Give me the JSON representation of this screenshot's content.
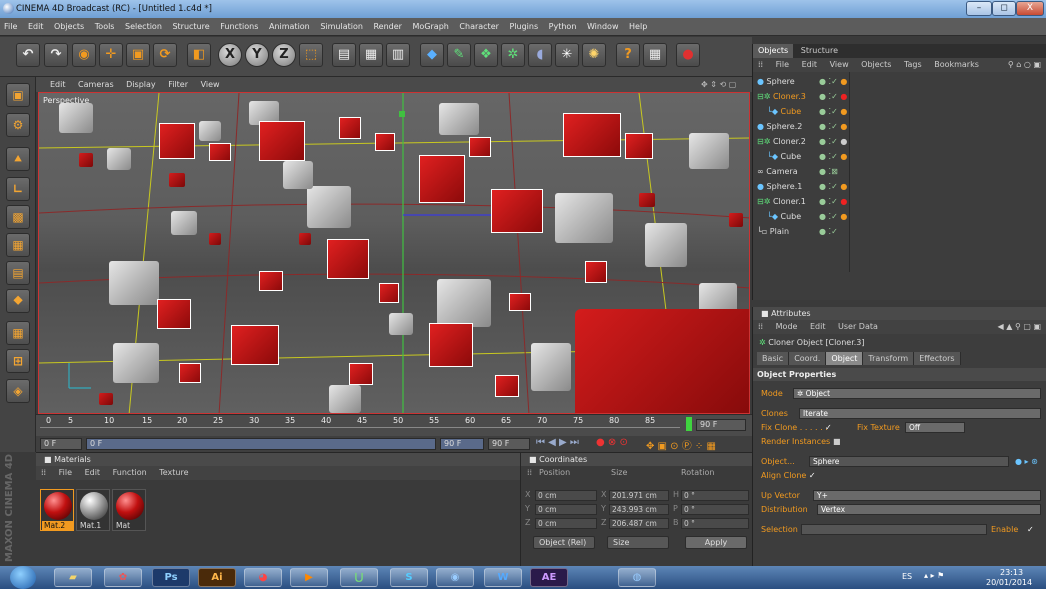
{
  "window": {
    "title": "CINEMA 4D Broadcast (RC) - [Untitled 1.c4d *]",
    "minimize": "–",
    "maximize": "◻",
    "close": "X"
  },
  "menubar": [
    "File",
    "Edit",
    "Objects",
    "Tools",
    "Selection",
    "Structure",
    "Functions",
    "Animation",
    "Simulation",
    "Render",
    "MoGraph",
    "Character",
    "Plugins",
    "Python",
    "Window",
    "Help"
  ],
  "viewport": {
    "menu": [
      "Edit",
      "Cameras",
      "Display",
      "Filter",
      "View"
    ],
    "label": "Perspective"
  },
  "timeline": {
    "ticks": [
      "0",
      "5",
      "10",
      "15",
      "20",
      "25",
      "30",
      "35",
      "40",
      "45",
      "50",
      "55",
      "60",
      "65",
      "70",
      "75",
      "80",
      "85"
    ],
    "end_label": "90 F",
    "current": "0 F",
    "min": "0 F",
    "max_a": "90 F",
    "max_b": "90 F"
  },
  "materials": {
    "header": "Materials",
    "menu": [
      "File",
      "Edit",
      "Function",
      "Texture"
    ],
    "items": [
      {
        "name": "Mat.2",
        "color": "#c11010"
      },
      {
        "name": "Mat.1",
        "color": "#9a9a9a"
      },
      {
        "name": "Mat",
        "color": "#c11010"
      }
    ]
  },
  "coordinates": {
    "header": "Coordinates",
    "col_position": "Position",
    "col_size": "Size",
    "col_rotation": "Rotation",
    "rows": [
      {
        "axis": "X",
        "pos": "0 cm",
        "size": "201.971 cm",
        "rot_axis": "H",
        "rot": "0 °"
      },
      {
        "axis": "Y",
        "pos": "0 cm",
        "size": "243.993 cm",
        "rot_axis": "P",
        "rot": "0 °"
      },
      {
        "axis": "Z",
        "pos": "0 cm",
        "size": "206.487 cm",
        "rot_axis": "B",
        "rot": "0 °"
      }
    ],
    "mode": "Object (Rel)",
    "size_mode": "Size",
    "apply": "Apply"
  },
  "objects": {
    "tabs": [
      "Objects",
      "Structure"
    ],
    "menu": [
      "File",
      "Edit",
      "View",
      "Objects",
      "Tags",
      "Bookmarks"
    ],
    "items": [
      {
        "name": "Sphere",
        "selected": false
      },
      {
        "name": "Cloner.3",
        "selected": true
      },
      {
        "name": "Cube",
        "selected": true
      },
      {
        "name": "Sphere.2",
        "selected": false
      },
      {
        "name": "Cloner.2",
        "selected": false
      },
      {
        "name": "Cube",
        "selected": false
      },
      {
        "name": "Camera",
        "selected": false
      },
      {
        "name": "Sphere.1",
        "selected": false
      },
      {
        "name": "Cloner.1",
        "selected": false
      },
      {
        "name": "Cube",
        "selected": false
      },
      {
        "name": "Plain",
        "selected": false
      }
    ]
  },
  "attributes": {
    "header": "Attributes",
    "menu": [
      "Mode",
      "Edit",
      "User Data"
    ],
    "object_title": "Cloner Object [Cloner.3]",
    "tabs": [
      "Basic",
      "Coord.",
      "Object",
      "Transform",
      "Effectors"
    ],
    "section": "Object Properties",
    "mode_label": "Mode",
    "mode_value": "Object",
    "clones_label": "Clones",
    "clones_value": "Iterate",
    "fix_clone_label": "Fix Clone . . . . . .",
    "fix_texture_label": "Fix Texture",
    "fix_texture_value": "Off",
    "render_instances_label": "Render Instances",
    "object_label": "Object...",
    "object_value": "Sphere",
    "align_clone_label": "Align Clone",
    "up_vector_label": "Up Vector",
    "up_vector_value": "Y+",
    "distribution_label": "Distribution",
    "distribution_value": "Vertex",
    "selection_label": "Selection",
    "enable_label": "Enable"
  },
  "taskbar": {
    "apps": [
      "",
      "",
      "",
      "Ps",
      "Ai",
      "",
      "",
      "",
      "S",
      "",
      "W",
      "AE",
      ""
    ],
    "lang": "ES",
    "time": "23:13",
    "date": "20/01/2014"
  }
}
